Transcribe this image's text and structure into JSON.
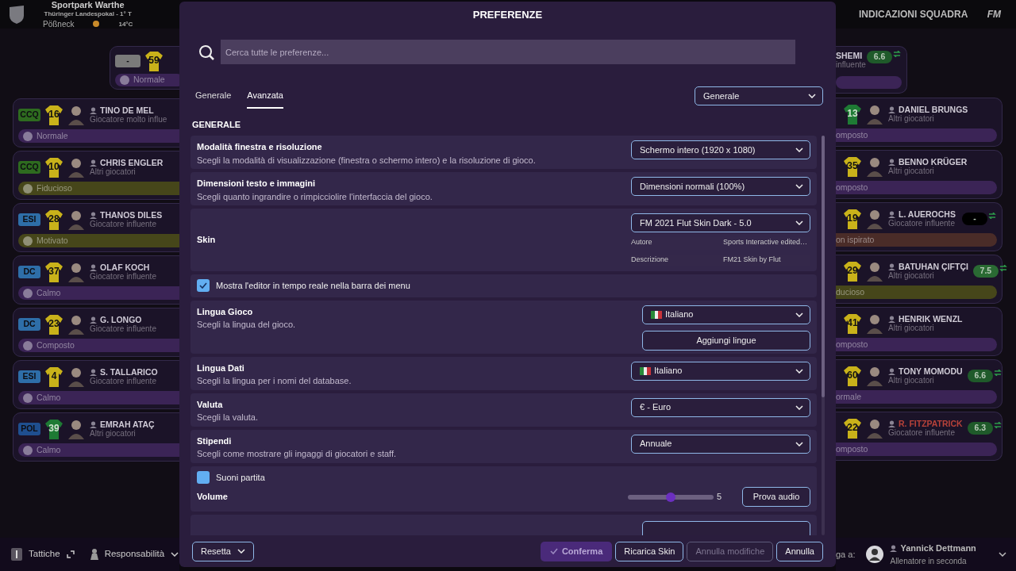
{
  "top_bar": {
    "venue": "Sportpark Warthe",
    "competition": "Thüringer Landespokal - 1° T",
    "city": "Pößneck",
    "temperature": "14°C",
    "section_title": "INDICAZIONI SQUADRA",
    "brand": "FM"
  },
  "left_top_card": {
    "position": {
      "label": "-",
      "color": "#7a7a7a"
    },
    "shirt": {
      "number": "59",
      "kind": "yellow"
    },
    "mood": {
      "label": "Normale",
      "color": "#3b2456"
    }
  },
  "left_players": [
    {
      "position": {
        "label": "CCQ",
        "color": "#2e6b1f"
      },
      "shirt": {
        "number": "16",
        "kind": "yellow"
      },
      "name": "TINO DE MEL",
      "role": "Giocatore molto influe",
      "mood": {
        "label": "Normale",
        "color": "#3b2456"
      }
    },
    {
      "position": {
        "label": "CCQ",
        "color": "#2e6b1f"
      },
      "shirt": {
        "number": "10",
        "kind": "yellow"
      },
      "name": "CHRIS ENGLER",
      "role": "Altri giocatori",
      "mood": {
        "label": "Fiducioso",
        "color": "#46461a"
      }
    },
    {
      "position": {
        "label": "ESI",
        "color": "#2e6ea8"
      },
      "shirt": {
        "number": "28",
        "kind": "yellow"
      },
      "name": "THANOS DILES",
      "role": "Giocatore influente",
      "mood": {
        "label": "Motivato",
        "color": "#46461a"
      }
    },
    {
      "position": {
        "label": "DC",
        "color": "#2e6ea8"
      },
      "shirt": {
        "number": "37",
        "kind": "yellow"
      },
      "name": "OLAF KOCH",
      "role": "Giocatore influente",
      "mood": {
        "label": "Calmo",
        "color": "#3b2456"
      }
    },
    {
      "position": {
        "label": "DC",
        "color": "#2e6ea8"
      },
      "shirt": {
        "number": "23",
        "kind": "yellow"
      },
      "name": "G. LONGO",
      "role": "Giocatore influente",
      "mood": {
        "label": "Composto",
        "color": "#3b2456"
      }
    },
    {
      "position": {
        "label": "ESI",
        "color": "#2e6ea8"
      },
      "shirt": {
        "number": "4",
        "kind": "yellow"
      },
      "name": "S. TALLARICO",
      "role": "Giocatore influente",
      "mood": {
        "label": "Calmo",
        "color": "#3b2456"
      }
    },
    {
      "position": {
        "label": "POL",
        "color": "#1f4f8f"
      },
      "shirt": {
        "number": "39",
        "kind": "green"
      },
      "name": "EMRAH ATAÇ",
      "role": "Altri giocatori",
      "mood": {
        "label": "Calmo",
        "color": "#3b2456"
      }
    }
  ],
  "right_top_card": {
    "name": "SHEMI",
    "role": "influente",
    "rating": {
      "value": "6.6",
      "color": "#1f5a2a"
    },
    "swap": true,
    "mood": {
      "color": "#3b2456"
    }
  },
  "right_players": [
    {
      "shirt": {
        "number": "13",
        "kind": "green"
      },
      "name": "DANIEL BRUNGS",
      "alert": false,
      "role": "Altri giocatori",
      "mood": {
        "label": "omposto",
        "color": "#3b2456"
      }
    },
    {
      "shirt": {
        "number": "35",
        "kind": "yellow"
      },
      "name": "BENNO KRÜGER",
      "alert": false,
      "role": "Altri giocatori",
      "mood": {
        "label": "omposto",
        "color": "#3b2456"
      }
    },
    {
      "shirt": {
        "number": "19",
        "kind": "yellow"
      },
      "name": "L. AUEROCHS",
      "alert": false,
      "role": "Giocatore influente",
      "mood": {
        "label": "on ispirato",
        "color": "#4a2c28"
      },
      "rating": {
        "value": "-",
        "color": "#000000"
      },
      "swap": true
    },
    {
      "shirt": {
        "number": "29",
        "kind": "yellow"
      },
      "name": "BATUHAN ÇIFTÇI",
      "alert": false,
      "role": "Altri giocatori",
      "mood": {
        "label": "ducioso",
        "color": "#46461a"
      },
      "rating": {
        "value": "7.5",
        "color": "#2a6a33"
      },
      "swap": true
    },
    {
      "shirt": {
        "number": "41",
        "kind": "yellow"
      },
      "name": "HENRIK WENZL",
      "alert": false,
      "role": "Altri giocatori",
      "mood": {
        "label": "omposto",
        "color": "#3b2456"
      }
    },
    {
      "shirt": {
        "number": "60",
        "kind": "yellow"
      },
      "name": "TONY MOMODU",
      "alert": false,
      "role": "Altri giocatori",
      "mood": {
        "label": "ormale",
        "color": "#3b2456"
      },
      "rating": {
        "value": "6.6",
        "color": "#1f5a2a"
      },
      "swap": true
    },
    {
      "shirt": {
        "number": "22",
        "kind": "yellow"
      },
      "name": "R. FITZPATRICK",
      "alert": true,
      "role": "Giocatore influente",
      "mood": {
        "label": "omposto",
        "color": "#3b2456"
      },
      "rating": {
        "value": "6.3",
        "color": "#1f5a2a"
      },
      "swap": true
    }
  ],
  "bottom_bar": {
    "tactics": "Tattiche",
    "responsibility": "Responsabilità",
    "report_label": "ga a:",
    "staff_name": "Yannick Dettmann",
    "staff_role": "Allenatore in seconda"
  },
  "dialog": {
    "title": "PREFERENZE",
    "search": {
      "placeholder": "Cerca tutte le preferenze..."
    },
    "tabs": [
      {
        "label": "Generale",
        "selected": false
      },
      {
        "label": "Avanzata",
        "selected": true
      }
    ],
    "category_select": "Generale",
    "section": "GENERALE",
    "rows": [
      {
        "kind": "select",
        "title": "Modalità finestra e risoluzione",
        "description": "Scegli la modalità di visualizzazione (finestra o schermo intero) e la risoluzione di gioco.",
        "value": "Schermo intero (1920 x 1080)"
      },
      {
        "kind": "select",
        "title": "Dimensioni testo e immagini",
        "description": "Scegli quanto ingrandire o rimpicciolire l'interfaccia del gioco.",
        "value": "Dimensioni normali (100%)"
      },
      {
        "kind": "skin",
        "title": "Skin",
        "value": "FM 2021 Flut Skin Dark - 5.0",
        "details": [
          {
            "label": "Autore",
            "value": "Sports Interactive edited…"
          },
          {
            "label": "Descrizione",
            "value": "FM21 Skin by Flut"
          }
        ]
      },
      {
        "kind": "checkbox",
        "label": "Mostra l'editor in tempo reale nella barra dei menu",
        "checked": true
      },
      {
        "kind": "select",
        "title": "Lingua Gioco",
        "description": "Scegli la lingua del gioco.",
        "value": "Italiano",
        "flag": true,
        "button": "Aggiungi lingue"
      },
      {
        "kind": "select",
        "title": "Lingua Dati",
        "description": "Scegli la lingua per i nomi del database.",
        "value": "Italiano",
        "flag": true
      },
      {
        "kind": "select",
        "title": "Valuta",
        "description": "Scegli la valuta.",
        "value": "€ - Euro"
      },
      {
        "kind": "select",
        "title": "Stipendi",
        "description": "Scegli come mostrare gli ingaggi di giocatori e staff.",
        "value": "Annuale"
      },
      {
        "kind": "audio",
        "label": "Suoni partita",
        "checked": false,
        "title": "Volume",
        "level": 0.5,
        "reading": "5",
        "button": "Prova audio"
      },
      {
        "kind": "partial"
      }
    ],
    "footer": {
      "reset": "Resetta",
      "buttons": [
        {
          "label": "Conferma",
          "kind": "primary",
          "disabled": false
        },
        {
          "label": "Ricarica Skin",
          "kind": "outline",
          "disabled": false
        },
        {
          "label": "Annulla modifiche",
          "kind": "outline",
          "disabled": true
        },
        {
          "label": "Annulla",
          "kind": "outline",
          "disabled": false
        }
      ]
    }
  }
}
